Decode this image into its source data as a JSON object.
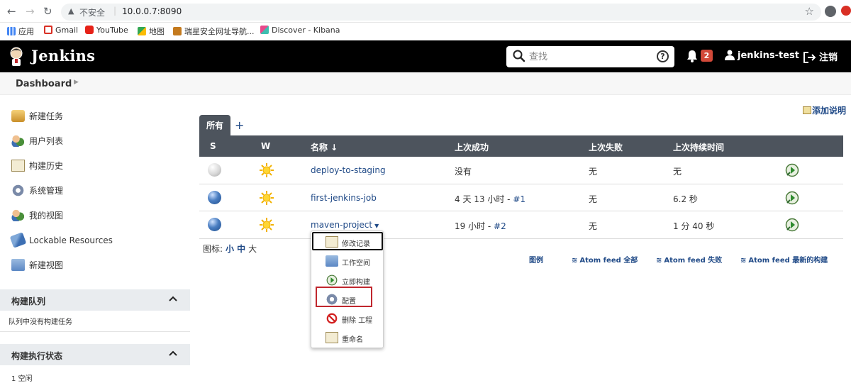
{
  "browser": {
    "security_label": "不安全",
    "url": "10.0.0.7:8090",
    "bookmarks": [
      {
        "label": "应用",
        "icon": "apps-grid-icon",
        "color": "#4285f4"
      },
      {
        "label": "Gmail",
        "icon": "gmail-icon",
        "color": "#d93025"
      },
      {
        "label": "YouTube",
        "icon": "youtube-icon",
        "color": "#e62117"
      },
      {
        "label": "地图",
        "icon": "maps-icon",
        "color": "#34a853"
      },
      {
        "label": "瑞星安全网址导航...",
        "icon": "rising-lion-icon",
        "color": "#c47a1e"
      },
      {
        "label": "Discover - Kibana",
        "icon": "kibana-icon",
        "color": "#e8488b"
      }
    ]
  },
  "header": {
    "brand": "Jenkins",
    "search_placeholder": "查找",
    "help": "?",
    "notification_count": "2",
    "username": "jenkins-test",
    "logout": "注销"
  },
  "breadcrumb": {
    "root": "Dashboard"
  },
  "sidebar": {
    "tasks": [
      {
        "label": "新建任务",
        "icon": "new-item-icon"
      },
      {
        "label": "用户列表",
        "icon": "people-icon"
      },
      {
        "label": "构建历史",
        "icon": "build-history-icon"
      },
      {
        "label": "系统管理",
        "icon": "manage-gear-icon"
      },
      {
        "label": "我的视图",
        "icon": "my-views-icon"
      },
      {
        "label": "Lockable Resources",
        "icon": "lockable-resources-icon"
      },
      {
        "label": "新建视图",
        "icon": "new-view-folder-icon"
      }
    ],
    "build_queue": {
      "title": "构建队列",
      "empty_text": "队列中没有构建任务"
    },
    "executors": {
      "title": "构建执行状态",
      "items": [
        "1  空闲"
      ]
    }
  },
  "main": {
    "add_description": "添加说明",
    "tabs": [
      {
        "label": "所有",
        "active": true
      }
    ],
    "add_tab": "+",
    "columns": {
      "s": "S",
      "w": "W",
      "name": "名称 ↓",
      "last_success": "上次成功",
      "last_failure": "上次失败",
      "last_duration": "上次持续时间"
    },
    "jobs": [
      {
        "status": "grey",
        "weather": "sunny",
        "name": "deploy-to-staging",
        "last_success_text": "没有",
        "last_success_build": "",
        "last_failure": "无",
        "duration": "无"
      },
      {
        "status": "blue",
        "weather": "sunny",
        "name": "first-jenkins-job",
        "last_success_text": "4 天 13 小时 - ",
        "last_success_build": "#1",
        "last_failure": "无",
        "duration": "6.2 秒"
      },
      {
        "status": "blue",
        "weather": "sunny",
        "name": "maven-project",
        "last_success_text": "19 小时 - ",
        "last_success_build": "#2",
        "last_failure": "无",
        "duration": "1 分 40 秒"
      }
    ],
    "icon_size": {
      "label": "图标:",
      "small": "小",
      "medium": "中",
      "large": "大"
    },
    "feeds": {
      "legend": "图例",
      "all": "Atom feed 全部",
      "failed": "Atom feed 失败",
      "latest": "Atom feed 最新的构建"
    }
  },
  "context_menu": {
    "items": [
      {
        "label": "修改记录",
        "icon": "changes-notepad-icon"
      },
      {
        "label": "工作空间",
        "icon": "workspace-folder-icon"
      },
      {
        "label": "立即构建",
        "icon": "build-now-icon"
      },
      {
        "label": "配置",
        "icon": "configure-gear-icon"
      },
      {
        "label": "删除 工程",
        "icon": "delete-no-icon"
      },
      {
        "label": "重命名",
        "icon": "rename-notepad-icon"
      }
    ]
  },
  "colors": {
    "header_bg": "#000000",
    "table_header_bg": "#4d545d",
    "link": "#204a87",
    "badge": "#d24939",
    "highlight_red": "#c0272d"
  }
}
